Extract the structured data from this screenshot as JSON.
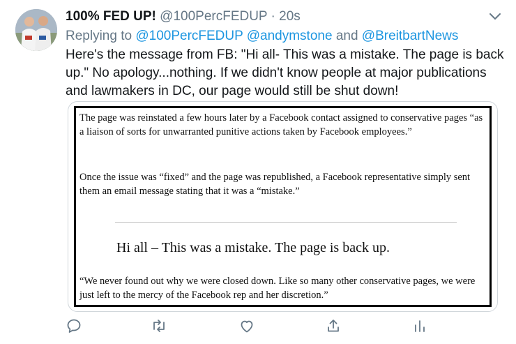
{
  "tweet": {
    "display_name": "100% FED UP!",
    "handle": "@100PercFEDUP",
    "separator": "·",
    "time": "20s",
    "replying_prefix": "Replying to",
    "replying_to": [
      "@100PercFEDUP",
      "@andymstone"
    ],
    "replying_and": "and",
    "replying_last": "@BreitbartNews",
    "text": "Here's the message from FB: \"Hi all- This was a mistake. The page is back up.\" No apology...nothing. If we didn't know people at major publications and lawmakers in DC, our page would still be shut down!"
  },
  "media": {
    "paragraph_1": "The page was reinstated a few hours later by a Facebook contact assigned to conservative pages “as a liaison of sorts for unwarranted punitive actions taken by Facebook employees.”",
    "paragraph_2": "Once the issue was “fixed” and the page was republished, a Facebook representative simply sent them an email message stating that it was a “mistake.”",
    "quote_message": "Hi all – This was a mistake. The page is back up.",
    "paragraph_3": "“We never found out why we were closed down. Like so many other conservative pages, we were just left to the mercy of the Facebook rep and her discretion.”"
  },
  "actions": [
    {
      "icon": "reply-icon"
    },
    {
      "icon": "retweet-icon"
    },
    {
      "icon": "like-icon"
    },
    {
      "icon": "share-icon"
    },
    {
      "icon": "analytics-icon"
    }
  ],
  "colors": {
    "text": "#14171a",
    "secondary": "#657786",
    "link": "#1b95e0"
  }
}
